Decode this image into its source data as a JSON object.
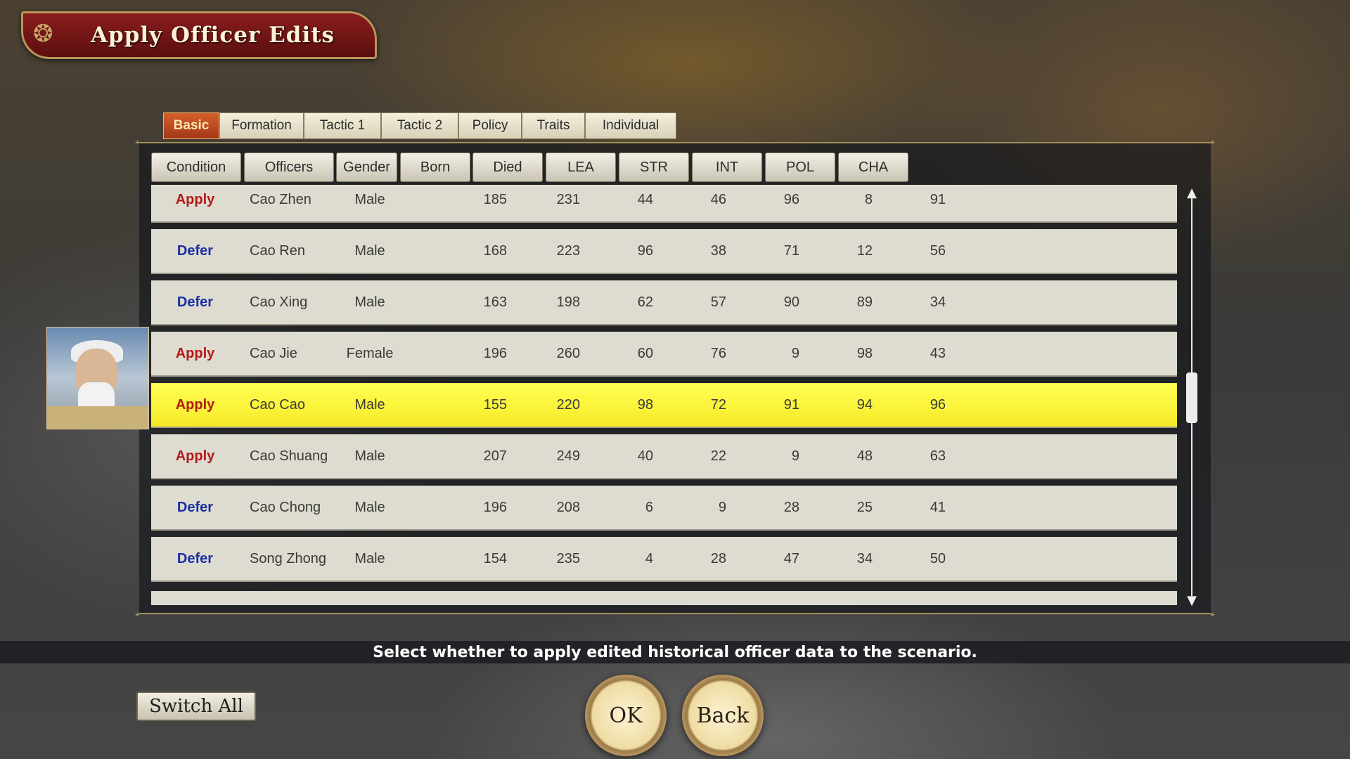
{
  "title": "Apply Officer Edits",
  "tabs": [
    "Basic",
    "Formation",
    "Tactic 1",
    "Tactic 2",
    "Policy",
    "Traits",
    "Individual"
  ],
  "active_tab": "Basic",
  "columns": [
    "Condition",
    "Officers",
    "Gender",
    "Born",
    "Died",
    "LEA",
    "STR",
    "INT",
    "POL",
    "CHA"
  ],
  "rows": [
    {
      "condition": "Apply",
      "name": "Cao Zhen",
      "gender": "Male",
      "born": "185",
      "died": "231",
      "lea": "44",
      "str": "46",
      "int": "96",
      "pol": "8",
      "cha": "91"
    },
    {
      "condition": "Defer",
      "name": "Cao Ren",
      "gender": "Male",
      "born": "168",
      "died": "223",
      "lea": "96",
      "str": "38",
      "int": "71",
      "pol": "12",
      "cha": "56"
    },
    {
      "condition": "Defer",
      "name": "Cao Xing",
      "gender": "Male",
      "born": "163",
      "died": "198",
      "lea": "62",
      "str": "57",
      "int": "90",
      "pol": "89",
      "cha": "34"
    },
    {
      "condition": "Apply",
      "name": "Cao Jie",
      "gender": "Female",
      "born": "196",
      "died": "260",
      "lea": "60",
      "str": "76",
      "int": "9",
      "pol": "98",
      "cha": "43"
    },
    {
      "condition": "Apply",
      "name": "Cao Cao",
      "gender": "Male",
      "born": "155",
      "died": "220",
      "lea": "98",
      "str": "72",
      "int": "91",
      "pol": "94",
      "cha": "96"
    },
    {
      "condition": "Apply",
      "name": "Cao Shuang",
      "gender": "Male",
      "born": "207",
      "died": "249",
      "lea": "40",
      "str": "22",
      "int": "9",
      "pol": "48",
      "cha": "63"
    },
    {
      "condition": "Defer",
      "name": "Cao Chong",
      "gender": "Male",
      "born": "196",
      "died": "208",
      "lea": "6",
      "str": "9",
      "int": "28",
      "pol": "25",
      "cha": "41"
    },
    {
      "condition": "Defer",
      "name": "Song Zhong",
      "gender": "Male",
      "born": "154",
      "died": "235",
      "lea": "4",
      "str": "28",
      "int": "47",
      "pol": "34",
      "cha": "50"
    }
  ],
  "selected_row": "Cao Cao",
  "hint": "Select whether to apply edited historical officer data to the scenario.",
  "buttons": {
    "switch_all": "Switch All",
    "ok": "OK",
    "back": "Back"
  },
  "colors": {
    "apply": "#b41818",
    "defer": "#1a2ea6",
    "selected_row": "#ffff52",
    "active_tab": "#c24b22"
  },
  "icons": {
    "portrait": "officer-portrait",
    "scroll_up": "arrow-up-icon",
    "scroll_down": "arrow-down-icon"
  }
}
